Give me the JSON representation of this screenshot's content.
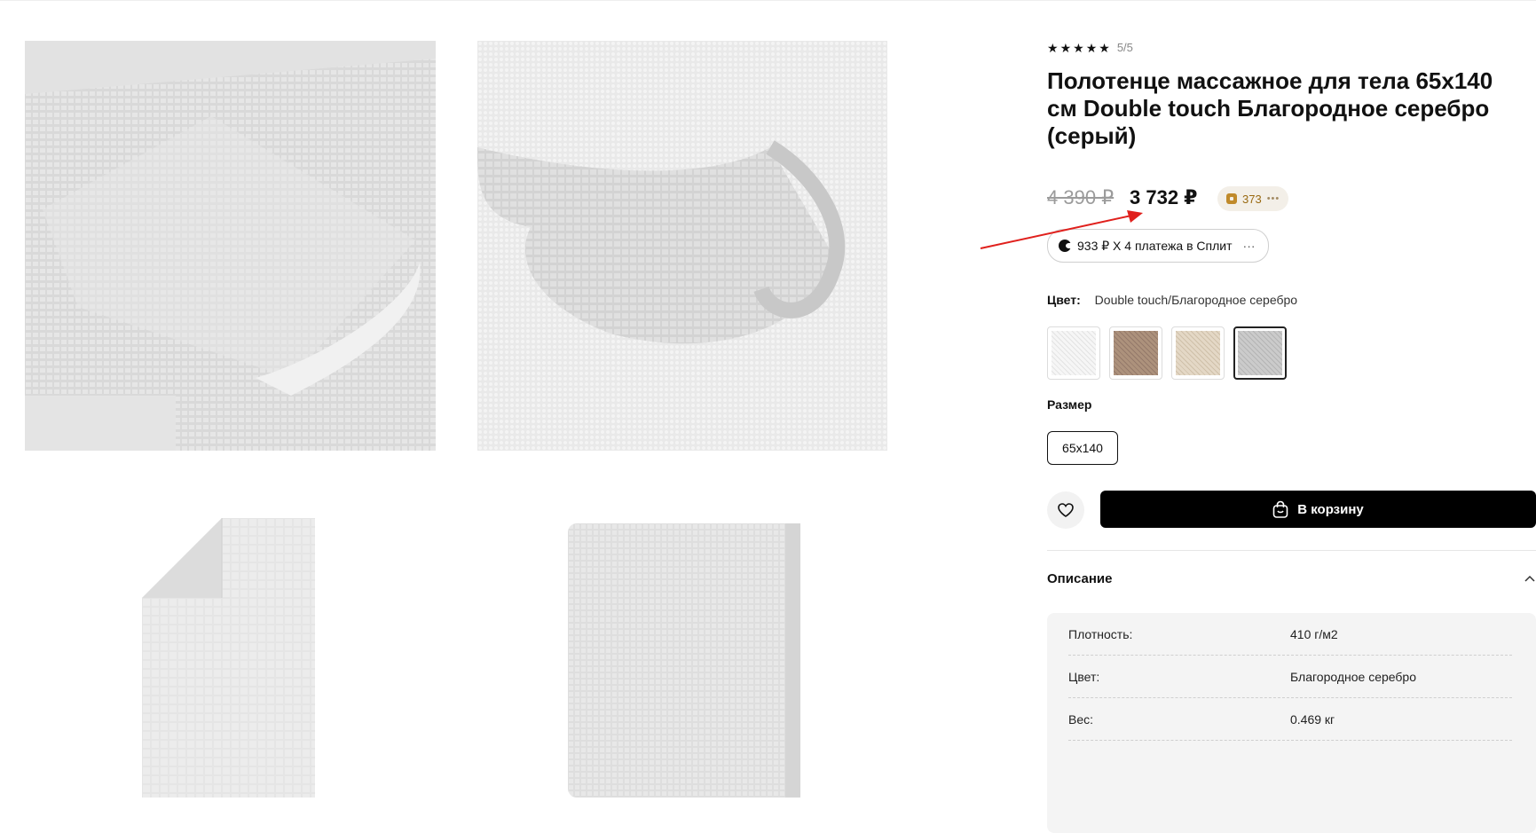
{
  "product": {
    "rating_value": "5/5",
    "title_lines": [
      "Полотенце массажное для тела 65х140",
      "см Double touch Благородное серебро",
      "(серый)"
    ],
    "old_price": "4 390 ₽",
    "price": "3 732 ₽",
    "bonus_points": "373",
    "split_text": "933 ₽ X 4 платежа в Сплит",
    "split_more": "···",
    "color_label": "Цвет:",
    "color_value": "Double touch/Благородное серебро",
    "swatches": [
      {
        "name": "white",
        "color": "#f3f4f5",
        "selected": false
      },
      {
        "name": "brown",
        "color": "#a88d76",
        "selected": false
      },
      {
        "name": "beige",
        "color": "#ddcfbb",
        "selected": false
      },
      {
        "name": "silver",
        "color": "#c7c8c9",
        "selected": true
      }
    ],
    "size_label": "Размер",
    "size_value": "65х140",
    "cart_button": "В корзину",
    "description_title": "Описание",
    "specs": [
      {
        "key": "Плотность:",
        "value": "410 г/м2"
      },
      {
        "key": "Цвет:",
        "value": "Благородное серебро"
      },
      {
        "key": "Вес:",
        "value": "0.469 кг"
      }
    ]
  },
  "colors": {
    "accent_red": "#e0201c",
    "button_black": "#000000"
  }
}
